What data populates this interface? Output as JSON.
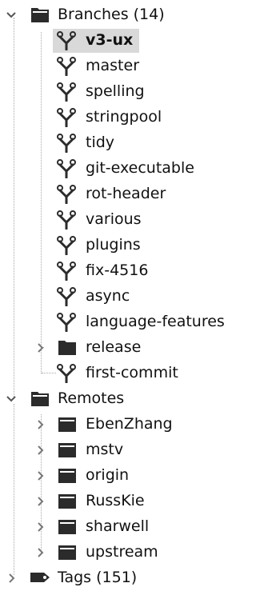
{
  "tree": {
    "branches_group": {
      "label": "Branches (14)",
      "icon": "folder-icon",
      "expanded": true,
      "items": [
        {
          "label": "v3-ux",
          "icon": "branch-icon",
          "selected": true,
          "bold": true
        },
        {
          "label": "master",
          "icon": "branch-icon"
        },
        {
          "label": "spelling",
          "icon": "branch-icon"
        },
        {
          "label": "stringpool",
          "icon": "branch-icon"
        },
        {
          "label": "tidy",
          "icon": "branch-icon"
        },
        {
          "label": "git-executable",
          "icon": "branch-icon"
        },
        {
          "label": "rot-header",
          "icon": "branch-icon"
        },
        {
          "label": "various",
          "icon": "branch-icon"
        },
        {
          "label": "plugins",
          "icon": "branch-icon"
        },
        {
          "label": "fix-4516",
          "icon": "branch-icon"
        },
        {
          "label": "async",
          "icon": "branch-icon"
        },
        {
          "label": "language-features",
          "icon": "branch-icon"
        },
        {
          "label": "release",
          "icon": "folder-icon",
          "expanded": false
        },
        {
          "label": "first-commit",
          "icon": "branch-icon"
        }
      ]
    },
    "remotes_group": {
      "label": "Remotes",
      "icon": "folder-icon",
      "expanded": true,
      "items": [
        {
          "label": "EbenZhang",
          "icon": "remote-icon",
          "expanded": false
        },
        {
          "label": "mstv",
          "icon": "remote-icon",
          "expanded": false
        },
        {
          "label": "origin",
          "icon": "remote-icon",
          "expanded": false
        },
        {
          "label": "RussKie",
          "icon": "remote-icon",
          "expanded": false
        },
        {
          "label": "sharwell",
          "icon": "remote-icon",
          "expanded": false
        },
        {
          "label": "upstream",
          "icon": "remote-icon",
          "expanded": false
        }
      ]
    },
    "tags_group": {
      "label": "Tags (151)",
      "icon": "tag-icon",
      "expanded": false
    }
  },
  "colors": {
    "selection": "#d9d9d9",
    "icon_dark": "#2b2b2b",
    "text": "#111111"
  }
}
